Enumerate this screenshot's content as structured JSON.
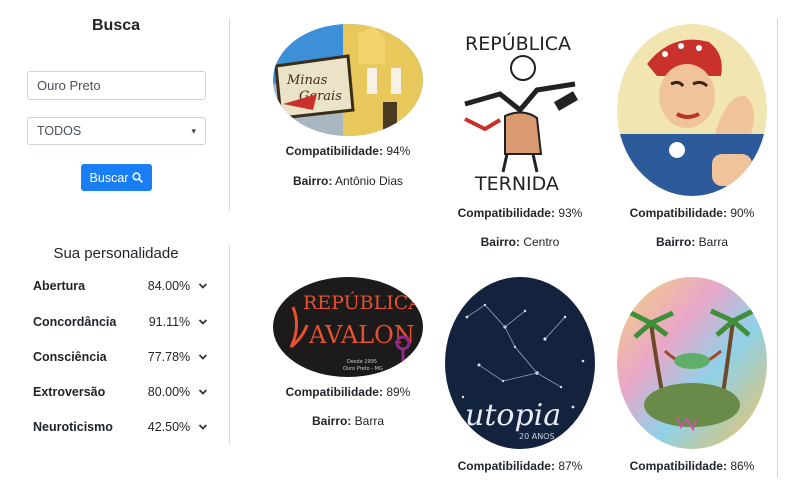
{
  "search": {
    "title": "Busca",
    "input_value": "Ouro Preto",
    "select_value": "TODOS",
    "button_label": "Buscar"
  },
  "personality": {
    "title": "Sua personalidade",
    "traits": [
      {
        "name": "Abertura",
        "value": "84.00%"
      },
      {
        "name": "Concordância",
        "value": "91.11%"
      },
      {
        "name": "Consciência",
        "value": "77.78%"
      },
      {
        "name": "Extroversão",
        "value": "80.00%"
      },
      {
        "name": "Neuroticismo",
        "value": "42.50%"
      }
    ]
  },
  "labels": {
    "compat": "Compatibilidade:",
    "bairro": "Bairro:"
  },
  "cards": [
    {
      "image": "minas-gerais-sign-church",
      "image_text": [
        "Minas",
        "Gerais"
      ],
      "compat": "94%",
      "bairro": "Antônio Dias"
    },
    {
      "image": "republica-eternidade-logo",
      "image_text": [
        "REPÚBLICA",
        "TERNIDA"
      ],
      "compat": "93%",
      "bairro": "Centro"
    },
    {
      "image": "we-can-do-it-woman",
      "image_text": [],
      "compat": "90%",
      "bairro": "Barra"
    },
    {
      "image": "republica-avalon-logo",
      "image_text": [
        "REPÚBLICA",
        "AVALON",
        "Desde 1995",
        "Ouro Preto - MG"
      ],
      "compat": "89%",
      "bairro": "Barra"
    },
    {
      "image": "utopia-constellations",
      "image_text": [
        "utopia",
        "20 ANOS"
      ],
      "compat": "87%",
      "bairro": ""
    },
    {
      "image": "hammock-island-painting",
      "image_text": [],
      "compat": "86%",
      "bairro": ""
    }
  ],
  "colors": {
    "button": "#1a7ff7",
    "divider": "#d9d9d9"
  }
}
